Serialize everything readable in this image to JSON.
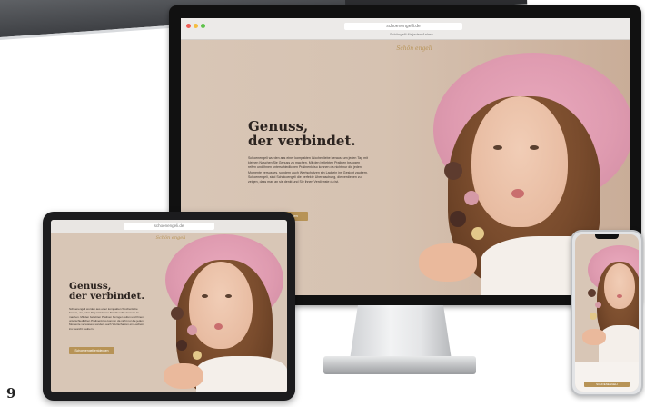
{
  "page_number": "9",
  "desktop": {
    "url": "schoenengelli.de",
    "tab_label": "Schöngelli für jeden Anlass",
    "logo": "Schön engeli",
    "title_line1": "Genuss,",
    "title_line2": "der verbindet.",
    "body": "Schoenengeli wurden aus einer kompakten Wochenliebe heraus, um jeden Tag mit kleinen Naschen Sie Genuss zu machen. Mit den beliebten Pralinen bezogen reifen und Ihnen unterschiedlichen Pralinenkriso konnen da nicht nur die jeden Momente versusses, sondern auch Wertschatzen ein Lachein ins Gesicht zaubern. Schoenengeli, sind Schokoengeli die perfekte Uberraschung, die verdienen zu zeigen, dass man an sie denkt und Sie ihnen Verdienste du ist.",
    "cta_label": "Schoenengeli entdecken"
  },
  "tablet": {
    "url": "schoenengeli.de",
    "logo": "Schön engeli",
    "title_line1": "Genuss,",
    "title_line2": "der verbindet.",
    "body": "Schoenengeli wurden aus einer kompakten Wochenliebe heraus, um jeden Tag mit kleinen Naschen Sie Genuss zu machen. Mit den beliebten Pralinen bezogen reifen und Ihnen unterschiedlichen Pralinenkriso konnen da nicht nur die jeden Momente versusses, sondern auch Wertschatzen ein Lachein ins Gesicht zaubern.",
    "cta_label": "Schoenengeli entdecken"
  },
  "phone": {
    "cta_label": "SCHOENENGELI"
  },
  "colors": {
    "accent": "#b79356",
    "hat_pink": "#df9bb0",
    "background": "#d8c6b6"
  }
}
